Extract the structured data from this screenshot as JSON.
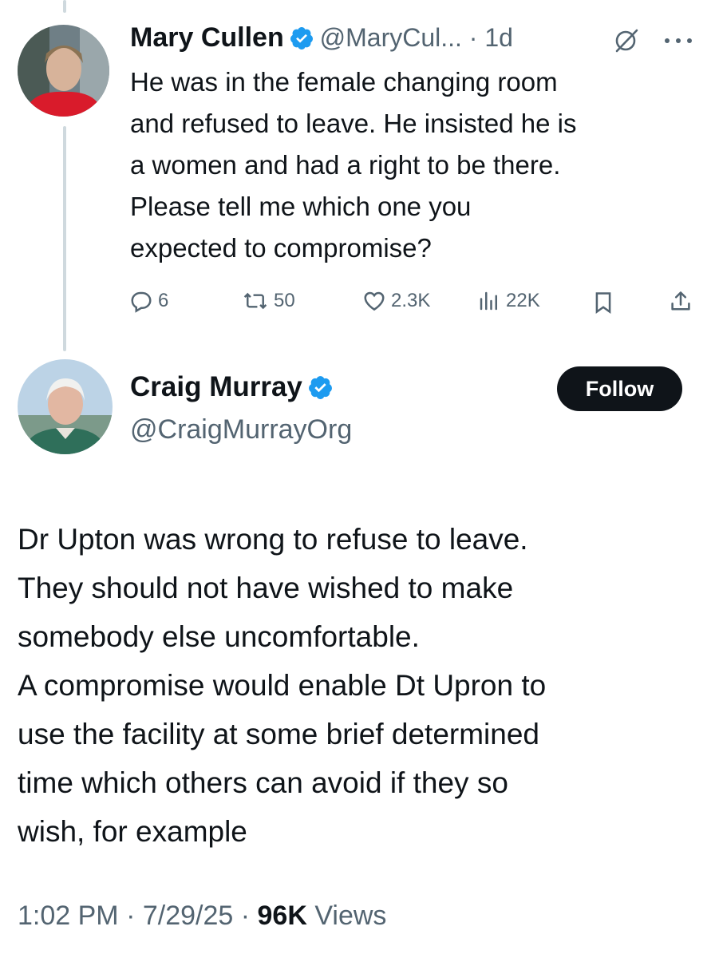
{
  "reply_tweet": {
    "author_name": "Mary Cullen",
    "handle_time": "@MaryCul... · 1d",
    "text_lines": [
      "He was in the female changing room",
      "and refused to leave.  He insisted he is",
      "a women and had a right to be there.",
      "Please tell me which one you",
      "expected to compromise?"
    ],
    "stats": {
      "replies": "6",
      "reposts": "50",
      "likes": "2.3K",
      "views": "22K"
    }
  },
  "main_tweet": {
    "author_name": "Craig Murray",
    "handle": "@CraigMurrayOrg",
    "follow_label": "Follow",
    "text_lines": [
      "Dr Upton was wrong to refuse to leave.",
      "They should not have wished to make",
      "somebody else uncomfortable.",
      "A compromise would enable Dt Upron to",
      "use the facility at some brief determined",
      "time which others can avoid if they so",
      "wish, for example"
    ],
    "meta": {
      "time_date": "1:02 PM · 7/29/25 · ",
      "views_count": "96K",
      "views_label": " Views"
    }
  },
  "colors": {
    "verified": "#1d9bf0",
    "text": "#0f1419",
    "muted": "#536471",
    "line": "#cfd9de"
  },
  "icons": [
    "verified-badge-icon",
    "grok-icon",
    "more-icon",
    "reply-icon",
    "repost-icon",
    "like-icon",
    "views-icon",
    "bookmark-icon",
    "share-icon"
  ]
}
